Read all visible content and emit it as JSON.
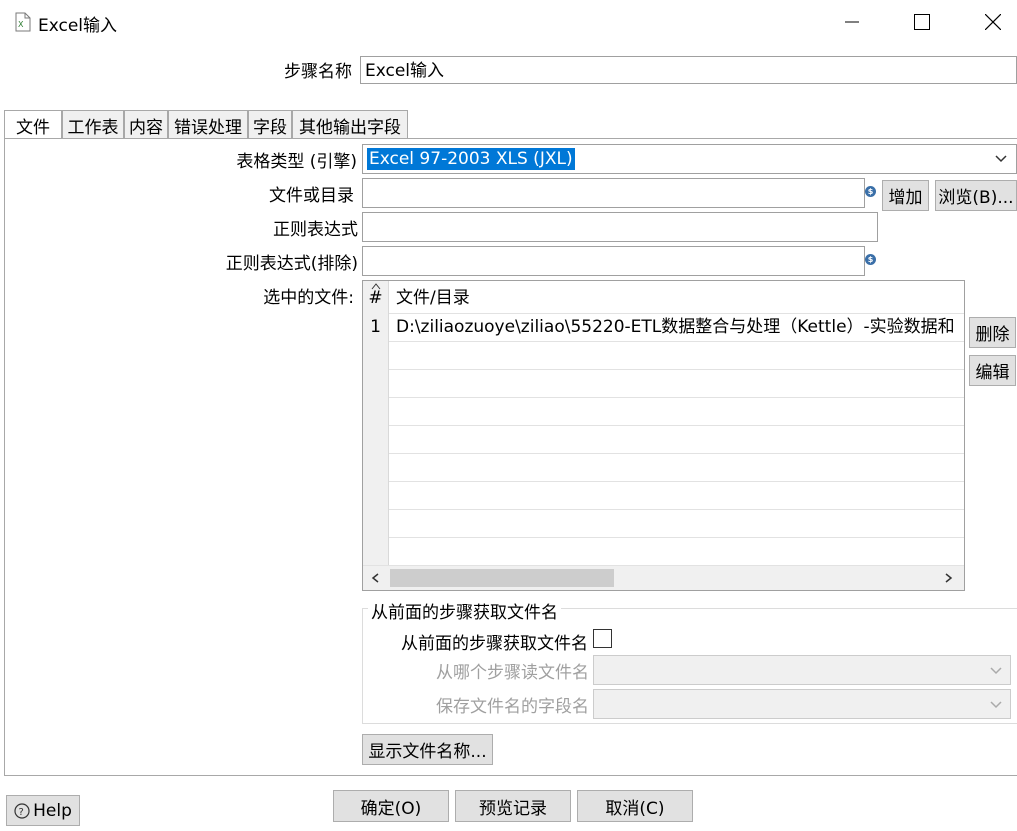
{
  "window": {
    "title": "Excel输入"
  },
  "step_name": {
    "label": "步骤名称",
    "value": "Excel输入"
  },
  "tabs": [
    {
      "label": "文件"
    },
    {
      "label": "工作表"
    },
    {
      "label": "内容"
    },
    {
      "label": "错误处理"
    },
    {
      "label": "字段"
    },
    {
      "label": "其他输出字段"
    }
  ],
  "file_tab": {
    "spreadsheet_type": {
      "label": "表格类型 (引擎)",
      "value": "Excel 97-2003 XLS (JXL)"
    },
    "file_or_dir": {
      "label": "文件或目录",
      "value": "",
      "add_label": "增加",
      "browse_label": "浏览(B)..."
    },
    "regex": {
      "label": "正则表达式",
      "value": ""
    },
    "regex_exclude": {
      "label": "正则表达式(排除)",
      "value": ""
    },
    "selected_files": {
      "label": "选中的文件:",
      "columns": [
        "#",
        "文件/目录"
      ],
      "rows": [
        {
          "num": "1",
          "path": "D:\\ziliaozuoye\\ziliao\\55220-ETL数据整合与处理（Kettle）-实验数据和"
        }
      ],
      "delete_label": "删除",
      "edit_label": "编辑"
    },
    "from_previous": {
      "group_title": "从前面的步骤获取文件名",
      "checkbox_label": "从前面的步骤获取文件名",
      "checked": false,
      "step_label": "从哪个步骤读文件名",
      "field_label": "保存文件名的字段名"
    },
    "show_filenames_label": "显示文件名称..."
  },
  "footer": {
    "help_label": "Help",
    "ok_label": "确定(O)",
    "preview_label": "预览记录",
    "cancel_label": "取消(C)"
  }
}
